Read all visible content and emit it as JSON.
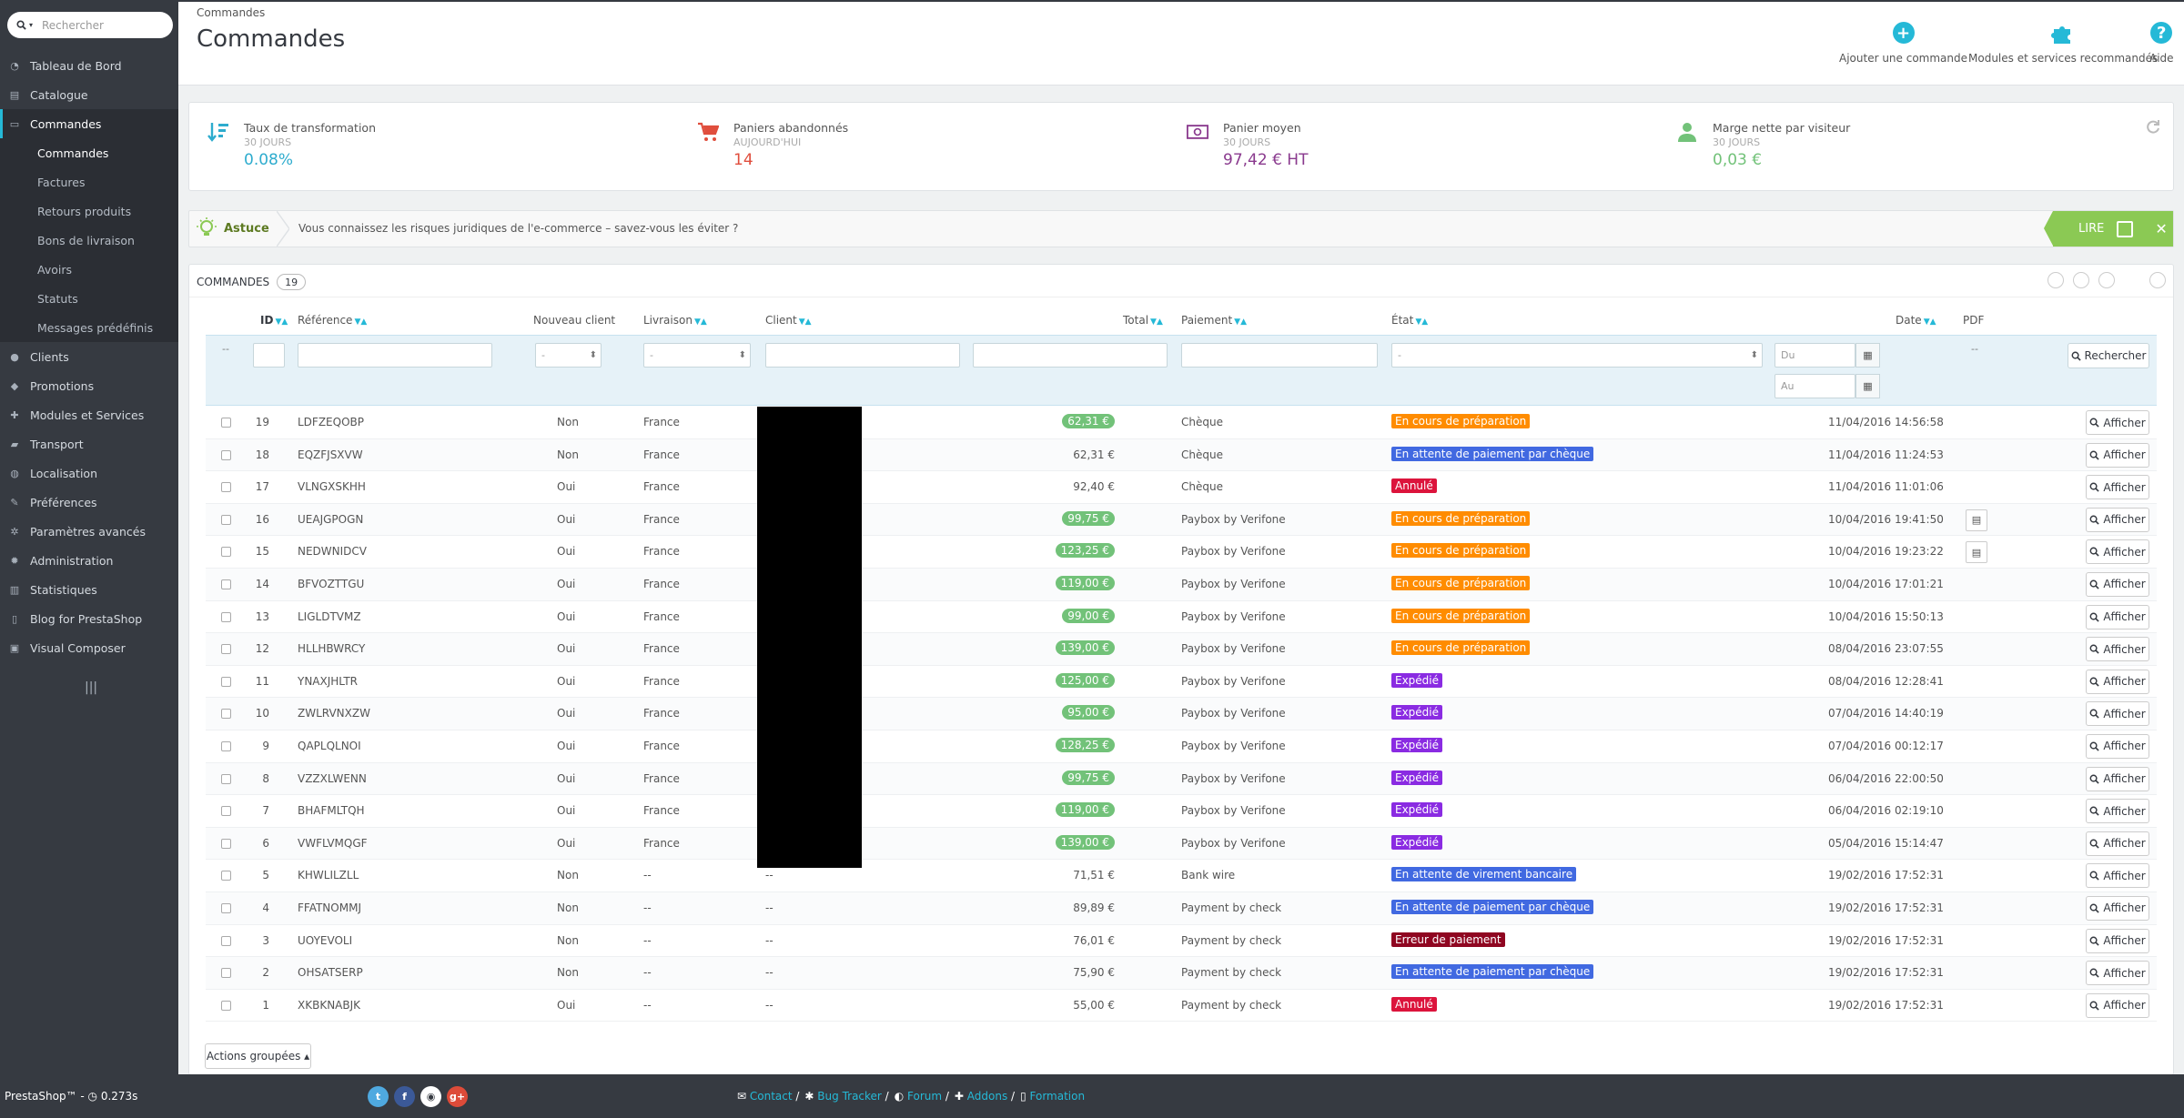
{
  "search": {
    "placeholder": "Rechercher"
  },
  "sidebar": {
    "items": [
      {
        "label": "Tableau de Bord",
        "icon": "dashboard-icon"
      },
      {
        "label": "Catalogue",
        "icon": "catalog-icon"
      },
      {
        "label": "Commandes",
        "icon": "orders-icon",
        "active": true
      },
      {
        "label": "Clients",
        "icon": "customers-icon"
      },
      {
        "label": "Promotions",
        "icon": "promotions-icon"
      },
      {
        "label": "Modules et Services",
        "icon": "modules-icon"
      },
      {
        "label": "Transport",
        "icon": "truck-icon"
      },
      {
        "label": "Localisation",
        "icon": "globe-icon"
      },
      {
        "label": "Préférences",
        "icon": "wrench-icon"
      },
      {
        "label": "Paramètres avancés",
        "icon": "cogs-icon"
      },
      {
        "label": "Administration",
        "icon": "gear-icon"
      },
      {
        "label": "Statistiques",
        "icon": "stats-icon"
      },
      {
        "label": "Blog for PrestaShop",
        "icon": "blog-icon"
      },
      {
        "label": "Visual Composer",
        "icon": "composer-icon"
      }
    ],
    "sub": [
      "Commandes",
      "Factures",
      "Retours produits",
      "Bons de livraison",
      "Avoirs",
      "Statuts",
      "Messages prédéfinis"
    ],
    "collapse": "|||",
    "footer": "PrestaShop™ - ◷ 0.273s"
  },
  "header": {
    "breadcrumb": "Commandes",
    "title": "Commandes",
    "add": "Ajouter une commande",
    "modules": "Modules et services recommandés",
    "help": "Aide"
  },
  "kpis": [
    {
      "title": "Taux de transformation",
      "sub": "30 JOURS",
      "value": "0.08%",
      "color": "#2eacce"
    },
    {
      "title": "Paniers abandonnés",
      "sub": "AUJOURD'HUI",
      "value": "14",
      "color": "#e04e3d"
    },
    {
      "title": "Panier moyen",
      "sub": "30 JOURS",
      "value": "97,42 € HT",
      "color": "#8a3a8e"
    },
    {
      "title": "Marge nette par visiteur",
      "sub": "30 JOURS",
      "value": "0,03 €",
      "color": "#72c279"
    }
  ],
  "tip": {
    "label": "Astuce",
    "message": "Vous connaissez les risques juridiques de l'e-commerce – savez-vous les éviter ?",
    "read": "LIRE"
  },
  "panel": {
    "title": "Commandes",
    "count": "19"
  },
  "columns": {
    "id": "ID",
    "ref": "Référence",
    "new": "Nouveau client",
    "delivery": "Livraison",
    "client": "Client",
    "total": "Total",
    "payment": "Paiement",
    "state": "État",
    "date": "Date",
    "pdf": "PDF"
  },
  "filters": {
    "dash": "--",
    "select": "-",
    "from": "Du",
    "to": "Au",
    "search": "Rechercher"
  },
  "orders": [
    {
      "id": "19",
      "ref": "LDFZEQOBP",
      "new": "Non",
      "country": "France",
      "client": "",
      "total": "62,31 €",
      "pill": true,
      "pay": "Chèque",
      "state": "En cours de préparation",
      "sc": "#ff8c00",
      "date": "11/04/2016 14:56:58",
      "pdf": false
    },
    {
      "id": "18",
      "ref": "EQZFJSXVW",
      "new": "Non",
      "country": "France",
      "client": "",
      "total": "62,31 €",
      "pill": false,
      "pay": "Chèque",
      "state": "En attente de paiement par chèque",
      "sc": "#4169e1",
      "date": "11/04/2016 11:24:53",
      "pdf": false
    },
    {
      "id": "17",
      "ref": "VLNGXSKHH",
      "new": "Oui",
      "country": "France",
      "client": "",
      "total": "92,40 €",
      "pill": false,
      "pay": "Chèque",
      "state": "Annulé",
      "sc": "#dc143c",
      "date": "11/04/2016 11:01:06",
      "pdf": false
    },
    {
      "id": "16",
      "ref": "UEAJGPOGN",
      "new": "Oui",
      "country": "France",
      "client": "",
      "total": "99,75 €",
      "pill": true,
      "pay": "Paybox by Verifone",
      "state": "En cours de préparation",
      "sc": "#ff8c00",
      "date": "10/04/2016 19:41:50",
      "pdf": true
    },
    {
      "id": "15",
      "ref": "NEDWNIDCV",
      "new": "Oui",
      "country": "France",
      "client": "",
      "total": "123,25 €",
      "pill": true,
      "pay": "Paybox by Verifone",
      "state": "En cours de préparation",
      "sc": "#ff8c00",
      "date": "10/04/2016 19:23:22",
      "pdf": true
    },
    {
      "id": "14",
      "ref": "BFVOZTTGU",
      "new": "Oui",
      "country": "France",
      "client": "",
      "total": "119,00 €",
      "pill": true,
      "pay": "Paybox by Verifone",
      "state": "En cours de préparation",
      "sc": "#ff8c00",
      "date": "10/04/2016 17:01:21",
      "pdf": false
    },
    {
      "id": "13",
      "ref": "LIGLDTVMZ",
      "new": "Oui",
      "country": "France",
      "client": "",
      "total": "99,00 €",
      "pill": true,
      "pay": "Paybox by Verifone",
      "state": "En cours de préparation",
      "sc": "#ff8c00",
      "date": "10/04/2016 15:50:13",
      "pdf": false
    },
    {
      "id": "12",
      "ref": "HLLHBWRCY",
      "new": "Oui",
      "country": "France",
      "client": "",
      "total": "139,00 €",
      "pill": true,
      "pay": "Paybox by Verifone",
      "state": "En cours de préparation",
      "sc": "#ff8c00",
      "date": "08/04/2016 23:07:55",
      "pdf": false
    },
    {
      "id": "11",
      "ref": "YNAXJHLTR",
      "new": "Oui",
      "country": "France",
      "client": "",
      "total": "125,00 €",
      "pill": true,
      "pay": "Paybox by Verifone",
      "state": "Expédié",
      "sc": "#8a2be2",
      "date": "08/04/2016 12:28:41",
      "pdf": false
    },
    {
      "id": "10",
      "ref": "ZWLRVNXZW",
      "new": "Oui",
      "country": "France",
      "client": "",
      "total": "95,00 €",
      "pill": true,
      "pay": "Paybox by Verifone",
      "state": "Expédié",
      "sc": "#8a2be2",
      "date": "07/04/2016 14:40:19",
      "pdf": false
    },
    {
      "id": "9",
      "ref": "QAPLQLNOI",
      "new": "Oui",
      "country": "France",
      "client": "",
      "total": "128,25 €",
      "pill": true,
      "pay": "Paybox by Verifone",
      "state": "Expédié",
      "sc": "#8a2be2",
      "date": "07/04/2016 00:12:17",
      "pdf": false
    },
    {
      "id": "8",
      "ref": "VZZXLWENN",
      "new": "Oui",
      "country": "France",
      "client": "",
      "total": "99,75 €",
      "pill": true,
      "pay": "Paybox by Verifone",
      "state": "Expédié",
      "sc": "#8a2be2",
      "date": "06/04/2016 22:00:50",
      "pdf": false
    },
    {
      "id": "7",
      "ref": "BHAFMLTQH",
      "new": "Oui",
      "country": "France",
      "client": "",
      "total": "119,00 €",
      "pill": true,
      "pay": "Paybox by Verifone",
      "state": "Expédié",
      "sc": "#8a2be2",
      "date": "06/04/2016 02:19:10",
      "pdf": false
    },
    {
      "id": "6",
      "ref": "VWFLVMQGF",
      "new": "Oui",
      "country": "France",
      "client": "",
      "total": "139,00 €",
      "pill": true,
      "pay": "Paybox by Verifone",
      "state": "Expédié",
      "sc": "#8a2be2",
      "date": "05/04/2016 15:14:47",
      "pdf": false
    },
    {
      "id": "5",
      "ref": "KHWLILZLL",
      "new": "Non",
      "country": "--",
      "client": "--",
      "total": "71,51 €",
      "pill": false,
      "pay": "Bank wire",
      "state": "En attente de virement bancaire",
      "sc": "#4169e1",
      "date": "19/02/2016 17:52:31",
      "pdf": false
    },
    {
      "id": "4",
      "ref": "FFATNOMMJ",
      "new": "Non",
      "country": "--",
      "client": "--",
      "total": "89,89 €",
      "pill": false,
      "pay": "Payment by check",
      "state": "En attente de paiement par chèque",
      "sc": "#4169e1",
      "date": "19/02/2016 17:52:31",
      "pdf": false
    },
    {
      "id": "3",
      "ref": "UOYEVOLI",
      "new": "Non",
      "country": "--",
      "client": "--",
      "total": "76,01 €",
      "pill": false,
      "pay": "Payment by check",
      "state": "Erreur de paiement",
      "sc": "#8f0621",
      "date": "19/02/2016 17:52:31",
      "pdf": false
    },
    {
      "id": "2",
      "ref": "OHSATSERP",
      "new": "Non",
      "country": "--",
      "client": "--",
      "total": "75,90 €",
      "pill": false,
      "pay": "Payment by check",
      "state": "En attente de paiement par chèque",
      "sc": "#4169e1",
      "date": "19/02/2016 17:52:31",
      "pdf": false
    },
    {
      "id": "1",
      "ref": "XKBKNABJK",
      "new": "Oui",
      "country": "--",
      "client": "--",
      "total": "55,00 €",
      "pill": false,
      "pay": "Payment by check",
      "state": "Annulé",
      "sc": "#dc143c",
      "date": "19/02/2016 17:52:31",
      "pdf": false
    }
  ],
  "row_button": "Afficher",
  "bulk": "Actions groupées ▴",
  "footer": {
    "social": [
      "t",
      "f",
      "◉",
      "g+"
    ],
    "links": [
      "Contact",
      "Bug Tracker",
      "Forum",
      "Addons",
      "Formation"
    ]
  }
}
